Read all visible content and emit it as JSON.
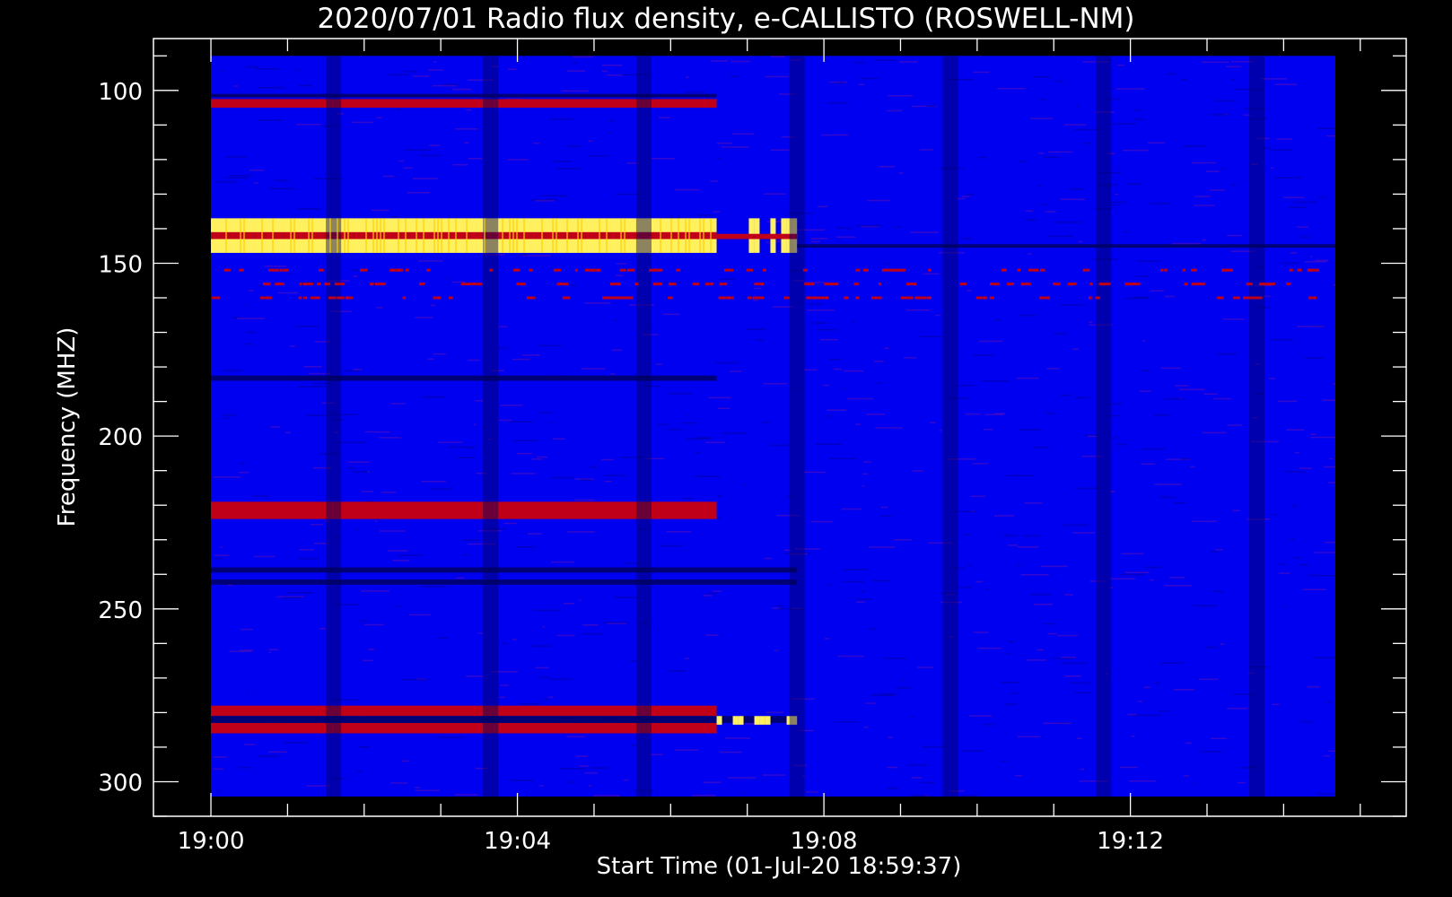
{
  "chart_data": {
    "type": "heatmap",
    "title": "2020/07/01  Radio flux density, e-CALLISTO (ROSWELL-NM)",
    "xlabel": "Start Time (01-Jul-20 18:59:37)",
    "ylabel": "Frequency (MHZ)",
    "x_ticks": [
      {
        "label": "19:00",
        "minutes": 0
      },
      {
        "label": "19:04",
        "minutes": 4
      },
      {
        "label": "19:08",
        "minutes": 8
      },
      {
        "label": "19:12",
        "minutes": 12
      }
    ],
    "y_ticks": [
      100,
      150,
      200,
      250,
      300
    ],
    "xlim_minutes": [
      -0.75,
      15.6
    ],
    "xdata_minutes": [
      0,
      15
    ],
    "ylim": [
      310,
      85
    ],
    "ydata": [
      90,
      307
    ],
    "grid": false,
    "colors": {
      "background": "#0000f0",
      "low": "#000060",
      "mid": "#c00018",
      "high": "#fff060",
      "axis": "#ffffff"
    },
    "features": [
      {
        "kind": "band",
        "freq": [
          137,
          147
        ],
        "t": [
          0,
          6.6
        ],
        "level": "high"
      },
      {
        "kind": "band",
        "freq": [
          141,
          143
        ],
        "t": [
          0,
          6.6
        ],
        "level": "mid"
      },
      {
        "kind": "band",
        "freq": [
          137,
          147
        ],
        "t": [
          6.95,
          7.65
        ],
        "level": "high",
        "intermittent": true
      },
      {
        "kind": "band",
        "freq": [
          141.5,
          143
        ],
        "t": [
          6.6,
          7.65
        ],
        "level": "mid"
      },
      {
        "kind": "line",
        "freq": [
          144.5,
          145.5
        ],
        "t": [
          7.65,
          15
        ],
        "level": "low"
      },
      {
        "kind": "line",
        "freq": [
          101,
          102
        ],
        "t": [
          0,
          6.6
        ],
        "level": "low"
      },
      {
        "kind": "band",
        "freq": [
          102.5,
          105
        ],
        "t": [
          0,
          6.6
        ],
        "level": "mid"
      },
      {
        "kind": "line",
        "freq": [
          182.5,
          184
        ],
        "t": [
          0,
          6.6
        ],
        "level": "low"
      },
      {
        "kind": "band",
        "freq": [
          219,
          224
        ],
        "t": [
          0,
          6.6
        ],
        "level": "mid"
      },
      {
        "kind": "line",
        "freq": [
          238,
          239.5
        ],
        "t": [
          0,
          7.65
        ],
        "level": "low"
      },
      {
        "kind": "line",
        "freq": [
          241.5,
          243
        ],
        "t": [
          0,
          7.65
        ],
        "level": "low"
      },
      {
        "kind": "band",
        "freq": [
          278,
          281
        ],
        "t": [
          0,
          6.6
        ],
        "level": "mid"
      },
      {
        "kind": "line",
        "freq": [
          281,
          283
        ],
        "t": [
          0,
          7.65
        ],
        "level": "low"
      },
      {
        "kind": "band",
        "freq": [
          283,
          286
        ],
        "t": [
          0,
          6.6
        ],
        "level": "mid"
      },
      {
        "kind": "band",
        "freq": [
          281,
          283.5
        ],
        "t": [
          6.6,
          7.65
        ],
        "level": "high",
        "intermittent": true
      },
      {
        "kind": "columns",
        "t": [
          1.6,
          3.65,
          5.65,
          7.65,
          9.65,
          11.65,
          13.65
        ],
        "width_min": 0.2,
        "level": "low"
      },
      {
        "kind": "dots",
        "freq": [
          152,
          156,
          160
        ],
        "t": [
          0,
          15
        ],
        "level": "mid"
      }
    ]
  }
}
